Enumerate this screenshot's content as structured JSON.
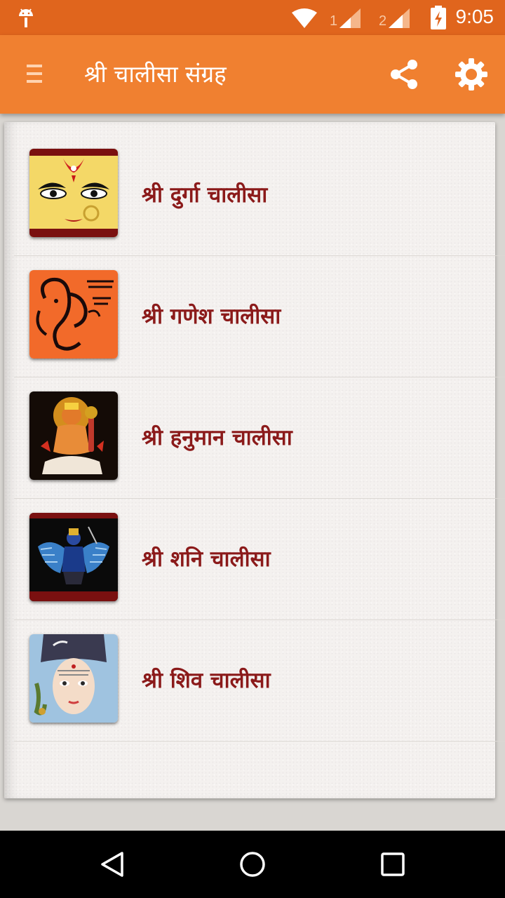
{
  "status_bar": {
    "time": "9:05",
    "notification_icon": "android-debug-icon",
    "sim1_label": "1",
    "sim2_label": "2",
    "colors": {
      "background": "#e0651d"
    }
  },
  "app_bar": {
    "title": "श्री चालीसा संग्रह",
    "menu_icon": "hamburger-menu-icon",
    "share_icon": "share-icon",
    "settings_icon": "gear-icon",
    "colors": {
      "background": "#f08030",
      "text": "#ffffff"
    }
  },
  "list": {
    "label_color": "#8b1a1a",
    "items": [
      {
        "label": "श्री दुर्गा चालीसा",
        "thumbnail": "durga-image"
      },
      {
        "label": "श्री गणेश चालीसा",
        "thumbnail": "ganesh-image"
      },
      {
        "label": "श्री हनुमान चालीसा",
        "thumbnail": "hanuman-image"
      },
      {
        "label": "श्री शनि चालीसा",
        "thumbnail": "shani-image"
      },
      {
        "label": "श्री शिव चालीसा",
        "thumbnail": "shiv-image"
      }
    ]
  },
  "nav_bar": {
    "back_icon": "back-triangle-icon",
    "home_icon": "home-circle-icon",
    "recents_icon": "recents-square-icon"
  }
}
